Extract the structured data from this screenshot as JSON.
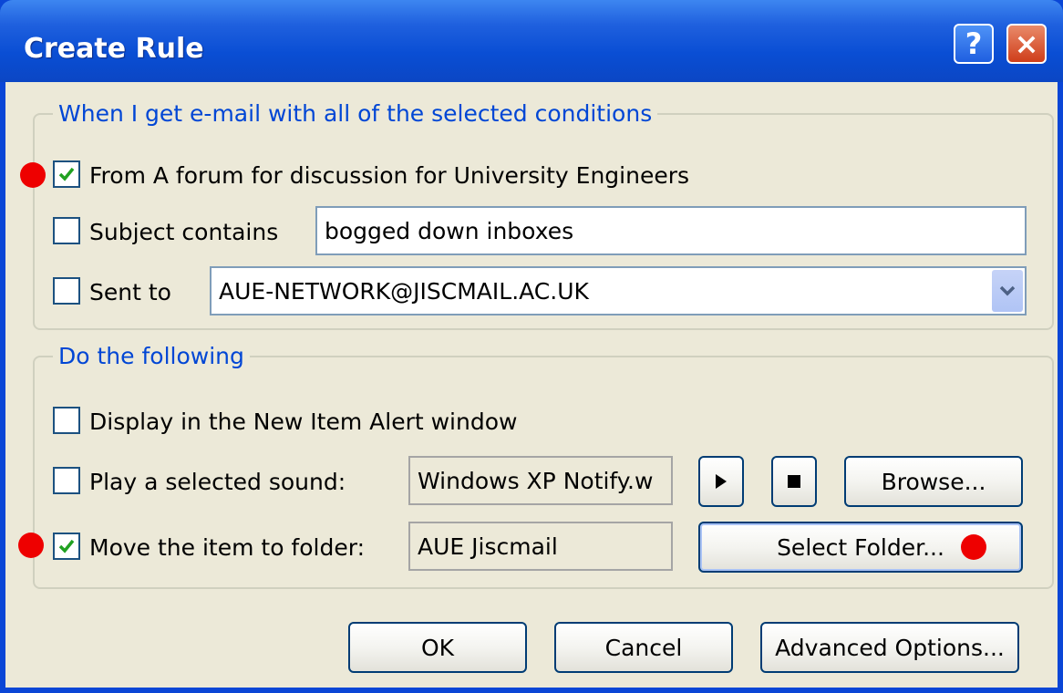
{
  "window": {
    "title": "Create Rule",
    "help_glyph": "?",
    "close_glyph": "×"
  },
  "conditions": {
    "legend": "When I get e-mail with all of the selected conditions",
    "from": {
      "label": "From A forum for discussion for University Engineers",
      "checked": true
    },
    "subject": {
      "label": "Subject contains",
      "value": "bogged down inboxes",
      "checked": false
    },
    "sent_to": {
      "label": "Sent to",
      "value": "AUE-NETWORK@JISCMAIL.AC.UK",
      "checked": false
    }
  },
  "actions": {
    "legend": "Do the following",
    "alert": {
      "label": "Display in the New Item Alert window",
      "checked": false
    },
    "sound": {
      "label": "Play a selected sound:",
      "value": "Windows XP Notify.w",
      "checked": false,
      "browse_label": "Browse..."
    },
    "move": {
      "label": "Move the item to folder:",
      "value": "AUE Jiscmail",
      "checked": true,
      "select_label": "Select Folder..."
    }
  },
  "buttons": {
    "ok": "OK",
    "cancel": "Cancel",
    "advanced": "Advanced Options..."
  },
  "colors": {
    "title_bar": "#0a4ed4",
    "legend": "#0046d5",
    "marker": "#ee0000",
    "dialog_bg": "#ece9d8"
  }
}
